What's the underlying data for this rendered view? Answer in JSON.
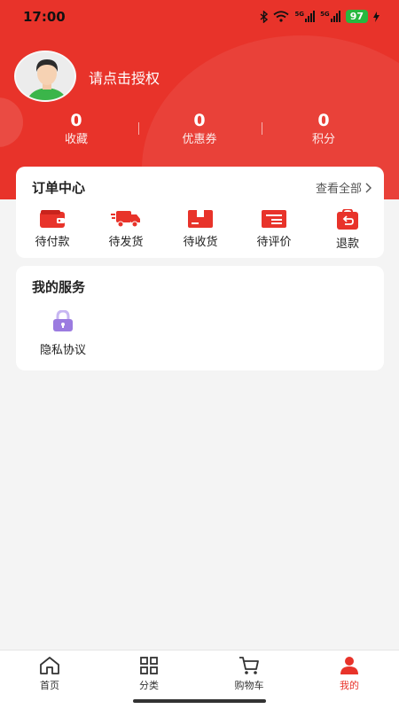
{
  "status": {
    "time": "17:00",
    "signal_label_1": "5G",
    "signal_label_2": "5G",
    "battery": "97"
  },
  "profile": {
    "login_prompt": "请点击授权"
  },
  "stats": [
    {
      "value": "0",
      "label": "收藏"
    },
    {
      "value": "0",
      "label": "优惠券"
    },
    {
      "value": "0",
      "label": "积分"
    }
  ],
  "orders": {
    "title": "订单中心",
    "view_all": "查看全部",
    "items": [
      {
        "label": "待付款",
        "icon": "wallet-icon"
      },
      {
        "label": "待发货",
        "icon": "truck-icon"
      },
      {
        "label": "待收货",
        "icon": "package-icon"
      },
      {
        "label": "待评价",
        "icon": "review-icon"
      },
      {
        "label": "退款",
        "icon": "refund-icon"
      }
    ]
  },
  "services": {
    "title": "我的服务",
    "items": [
      {
        "label": "隐私协议",
        "icon": "lock-icon"
      }
    ]
  },
  "tabbar": {
    "items": [
      {
        "label": "首页",
        "icon": "home-icon"
      },
      {
        "label": "分类",
        "icon": "grid-icon"
      },
      {
        "label": "购物车",
        "icon": "cart-icon"
      },
      {
        "label": "我的",
        "icon": "user-icon"
      }
    ],
    "active": "我的"
  },
  "colors": {
    "brand": "#e8332a",
    "battery": "#27b83f",
    "lock": "#9b7be0"
  }
}
